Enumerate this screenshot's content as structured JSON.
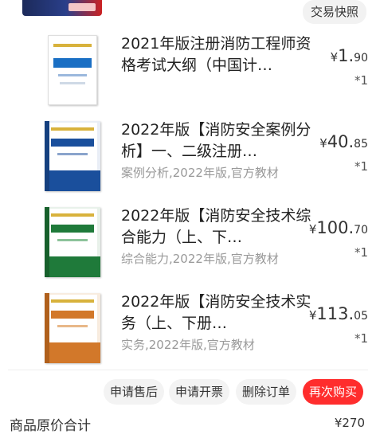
{
  "header": {
    "snapshot_label": "交易快照"
  },
  "items": [
    {
      "title": "2021年版注册消防工程师资格考试大纲（中国计…",
      "tags": "",
      "price_currency": "¥",
      "price_int": "1.",
      "price_dec": "90",
      "qty": "*1",
      "cover_color": "#1a6fc4"
    },
    {
      "title": "2022年版【消防安全案例分析】一、二级注册…",
      "tags": "案例分析,2022年版,官方教材",
      "price_currency": "¥",
      "price_int": "40.",
      "price_dec": "85",
      "qty": "*1",
      "cover_color": "#1a4f9c"
    },
    {
      "title": "2022年版【消防安全技术综合能力（上、下…",
      "tags": "综合能力,2022年版,官方教材",
      "price_currency": "¥",
      "price_int": "100.",
      "price_dec": "70",
      "qty": "*1",
      "cover_color": "#1f7a3a"
    },
    {
      "title": "2022年版【消防安全技术实务（上、下册…",
      "tags": "实务,2022年版,官方教材",
      "price_currency": "¥",
      "price_int": "113.",
      "price_dec": "05",
      "qty": "*1",
      "cover_color": "#d2782a"
    }
  ],
  "actions": {
    "after_sale": "申请售后",
    "invoice": "申请开票",
    "delete_order": "删除订单",
    "buy_again": "再次购买"
  },
  "summary": {
    "total_label": "商品原价合计",
    "total_value": "¥270"
  },
  "colors": {
    "accent": "#ff2d2d",
    "muted_text": "#999999"
  }
}
